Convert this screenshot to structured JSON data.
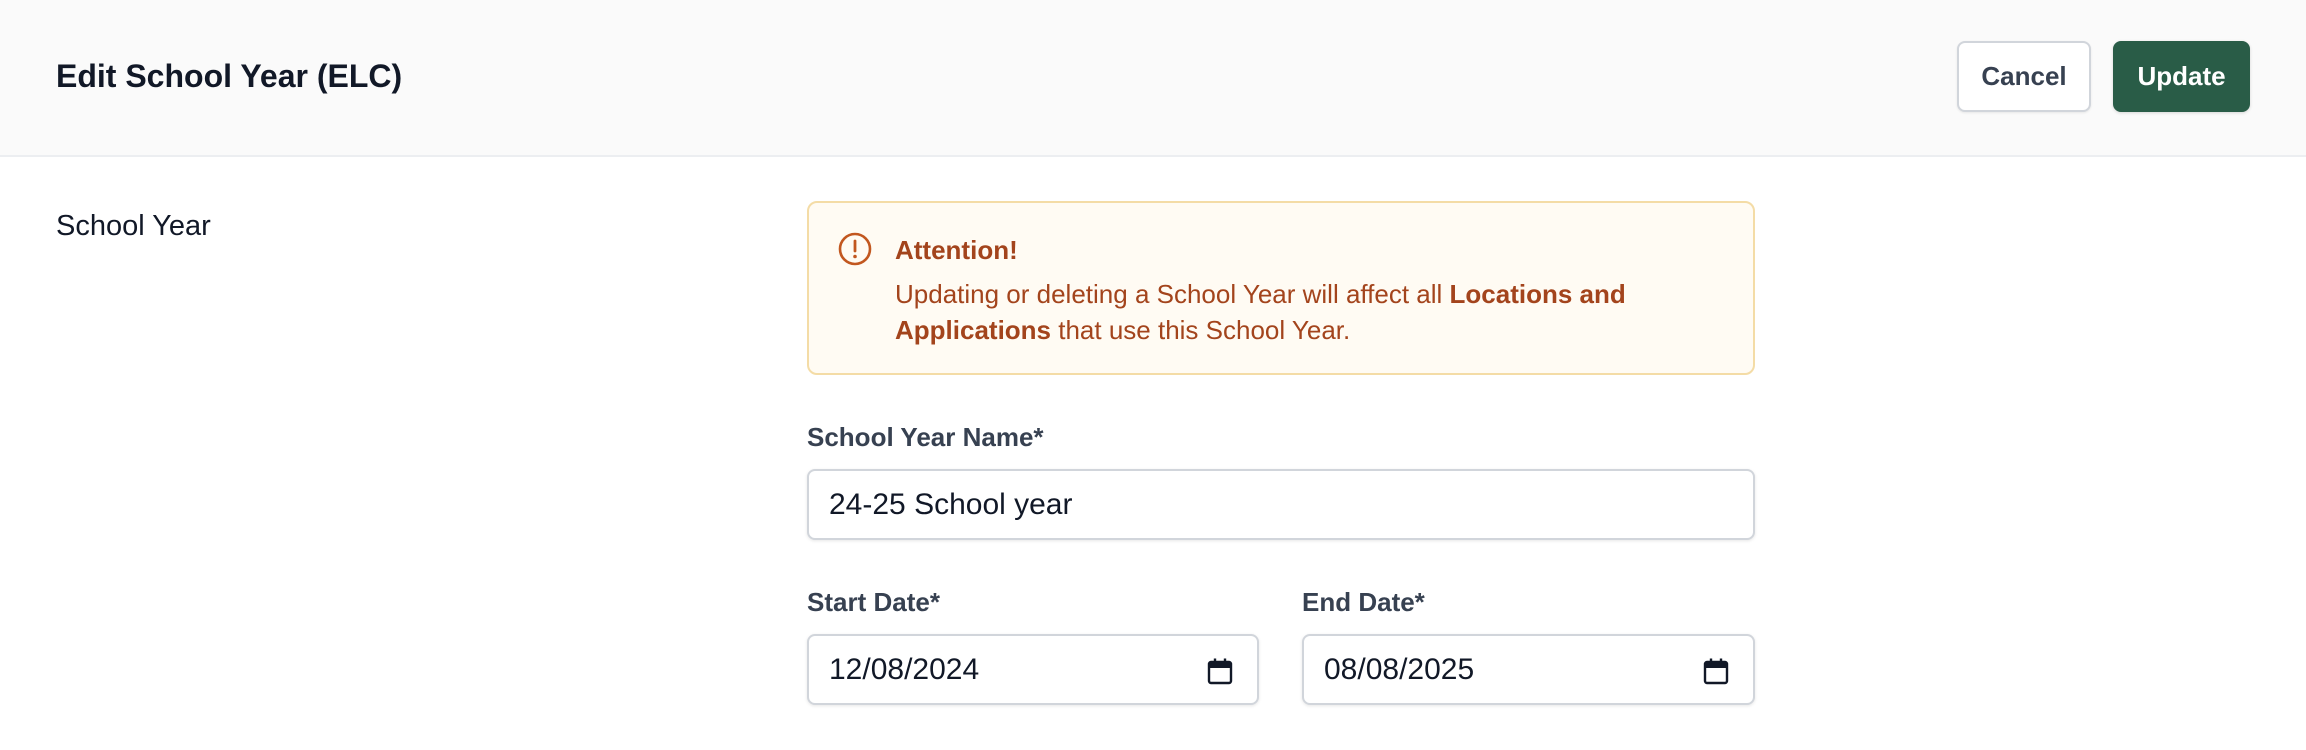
{
  "header": {
    "title": "Edit School Year (ELC)",
    "cancel_label": "Cancel",
    "update_label": "Update"
  },
  "section": {
    "label": "School Year"
  },
  "alert": {
    "icon": "exclamation-circle-icon",
    "title": "Attention!",
    "body_prefix": "Updating or deleting a School Year will affect all ",
    "body_bold": "Locations and Applications",
    "body_suffix": " that use this School Year."
  },
  "form": {
    "name_label": "School Year Name*",
    "name_value": "24-25 School year",
    "start_label": "Start Date*",
    "start_value": "12/08/2024",
    "end_label": "End Date*",
    "end_value": "08/08/2025",
    "calendar_icon": "calendar-icon"
  },
  "colors": {
    "primary": "#295c47",
    "warning_text": "#a3441c",
    "warning_bg": "#fffbf3",
    "warning_border": "#f4dca6"
  }
}
